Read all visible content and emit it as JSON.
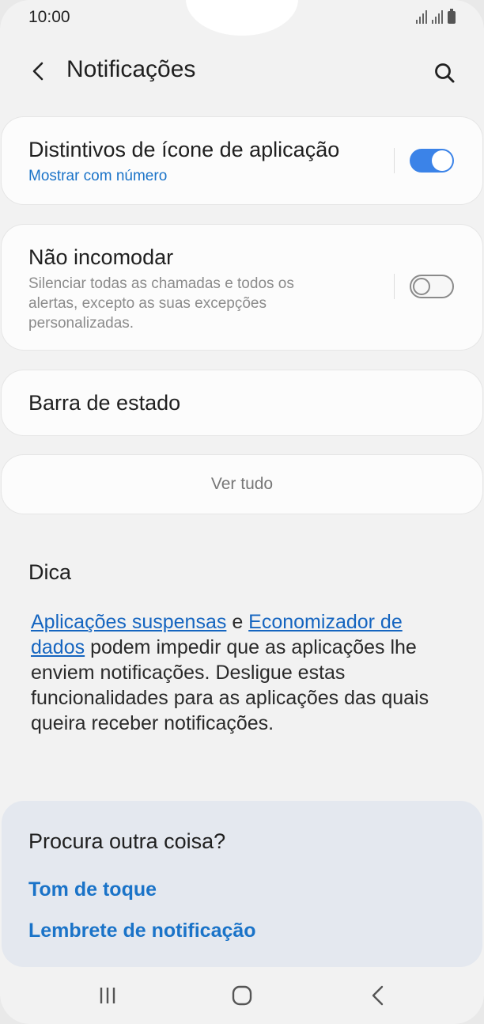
{
  "status_bar": {
    "time": "10:00"
  },
  "header": {
    "title": "Notificações"
  },
  "settings": {
    "badges": {
      "title": "Distintivos de ícone de aplicação",
      "subtitle": "Mostrar com número",
      "enabled": true
    },
    "dnd": {
      "title": "Não incomodar",
      "description": "Silenciar todas as chamadas e todos os alertas, excepto as suas excepções personalizadas.",
      "enabled": false
    },
    "status_bar_item": {
      "title": "Barra de estado"
    },
    "see_all": "Ver tudo"
  },
  "tip": {
    "title": "Dica",
    "link1": "Aplicações suspensas",
    "conj": " e ",
    "link2": "Economizador de dados",
    "rest": " podem impedir que as aplicações lhe enviem notificações. Desligue estas funcionalidades para as aplicações das quais queira receber notificações."
  },
  "suggestions": {
    "title": "Procura outra coisa?",
    "links": [
      "Tom de toque",
      "Lembrete de notificação"
    ]
  },
  "colors": {
    "accent": "#3b83e8",
    "link": "#1a73c8"
  },
  "icons": {
    "back": "chevron-left-icon",
    "search": "search-icon",
    "nav_recents": "recents-icon",
    "nav_home": "home-icon",
    "nav_back": "nav-back-icon"
  }
}
